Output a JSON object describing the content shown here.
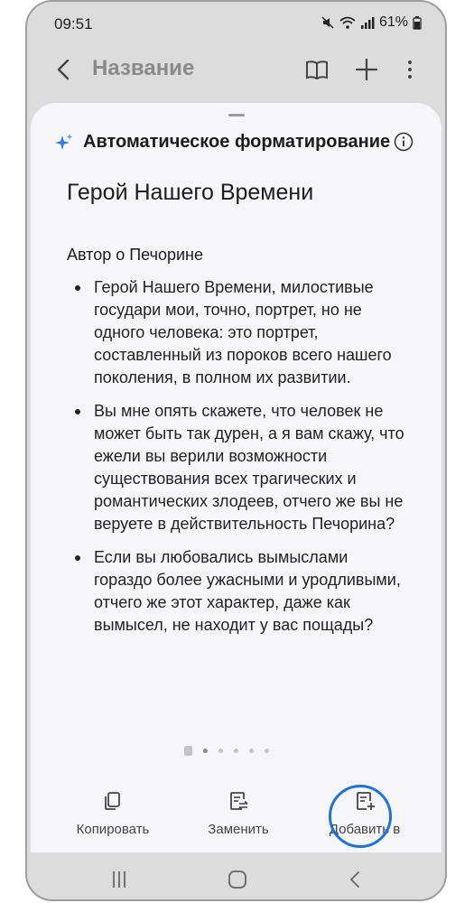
{
  "status_bar": {
    "time": "09:51",
    "battery": "61%"
  },
  "app_bar": {
    "title": "Название"
  },
  "sheet": {
    "title": "Автоматическое форматирование",
    "document_title": "Герой Нашего Времени",
    "section_heading": "Автор о Печорине",
    "bullets": [
      "Герой Нашего Времени, милостивые государи мои, точно, портрет, но не одного человека: это портрет, составленный из пороков всего нашего поколения, в полном их развитии.",
      "Вы мне опять скажете, что человек не может быть так дурен, а я вам скажу, что ежели вы верили возможности существования всех трагических и романтических злодеев, отчего же вы не веруете в действительность Печорина?",
      "Если вы любовались вымыслами гораздо более ужасными и уродливыми, отчего же этот характер, даже как вымысел, не находит у вас пощады?"
    ],
    "pager": {
      "pages": 6,
      "current": 1
    }
  },
  "actions": {
    "copy": "Копировать",
    "replace": "Заменить",
    "add_to": "Добавить в"
  },
  "colors": {
    "highlight_ring": "#1a73e8",
    "spark": "#2f7df6"
  }
}
